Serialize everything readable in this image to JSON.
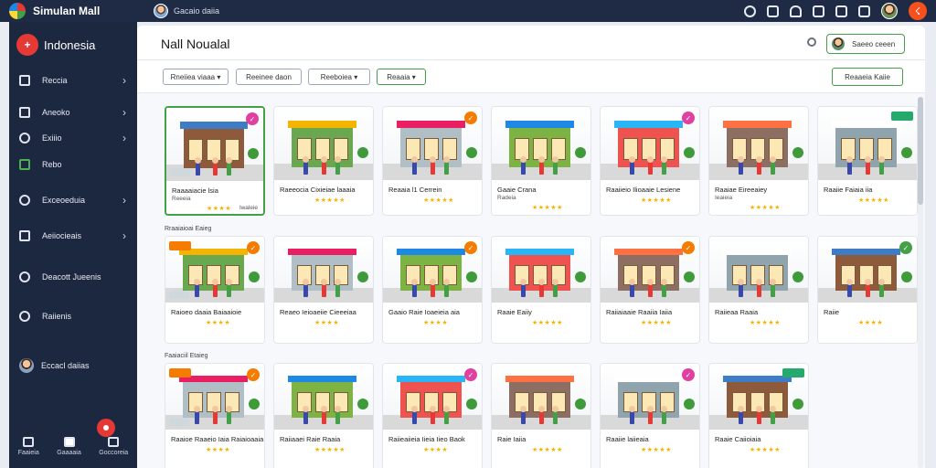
{
  "app": {
    "title": "Simulan Mall",
    "user_label": "Gacaio daiia",
    "accent": "#43a047",
    "top_icons": [
      "headset-icon",
      "menu-icon",
      "bell-icon",
      "instagram-icon",
      "chat-icon",
      "share-icon"
    ]
  },
  "sidebar": {
    "region_badge": "+",
    "region_label": "Indonesia",
    "items": [
      {
        "label": "Reccia",
        "icon": "store-icon",
        "chevron": "›"
      },
      {
        "label": "Aneoko",
        "icon": "grid-icon",
        "chevron": "›"
      },
      {
        "label": "Exiiio",
        "icon": "people-icon",
        "chevron": "›"
      },
      {
        "label": "Rebo",
        "icon": "camera-icon",
        "chevron": ""
      },
      {
        "label": "Exceoeduia",
        "icon": "settings-icon",
        "chevron": "›"
      },
      {
        "label": "Aeiiocieais",
        "icon": "upload-icon",
        "chevron": "›"
      },
      {
        "label": "Deacott Jueenis",
        "icon": "history-icon",
        "chevron": ""
      },
      {
        "label": "Raiienis",
        "icon": "help-icon",
        "chevron": ""
      }
    ],
    "user_label": "Eccacl daiias",
    "bottom_nav": [
      {
        "label": "Faaieia",
        "icon": "home-icon"
      },
      {
        "label": "Gaaaaia",
        "icon": "chat-icon"
      },
      {
        "label": "Goccoreia",
        "icon": "list-icon"
      }
    ]
  },
  "header": {
    "title": "Nall Noualal",
    "profile_label": "Saeeo ceeen"
  },
  "filters": [
    {
      "label": "Rneiiea viaaa",
      "chevron": "▾"
    },
    {
      "label": "Reeinee daon",
      "chevron": ""
    },
    {
      "label": "Reeboiea",
      "chevron": "▾"
    },
    {
      "label": "Reaaia",
      "chevron": "▾"
    }
  ],
  "action_button": "Reaaeia Kaiie",
  "sections": [
    "Rraaiaioai Eaieg",
    "Faaiaciil Etaieg"
  ],
  "rows": [
    [
      {
        "name": "Raaaaiacie lsia",
        "meta": "Reeeia",
        "stars": "★★★★",
        "extra": "lwaleie",
        "badge": "✓",
        "badge_color": "#e040a0",
        "selected": true
      },
      {
        "name": "Raeeocia Cixieiae laaaia",
        "meta": "",
        "stars": "★★★★★",
        "extra": "",
        "badge": "",
        "badge_color": "",
        "selected": false
      },
      {
        "name": "Reaaia l1 Cerrein",
        "meta": "",
        "stars": "★★★★★",
        "extra": "",
        "badge": "✓",
        "badge_color": "#f57c00",
        "selected": false
      },
      {
        "name": "Gaaie Crana",
        "meta": "Radeia",
        "stars": "★★★★★",
        "extra": "",
        "badge": "",
        "badge_color": "",
        "selected": false
      },
      {
        "name": "Raaiieio Ilioaaie Lesiene",
        "meta": "",
        "stars": "★★★★★",
        "extra": "",
        "badge": "✓",
        "badge_color": "#e040a0",
        "selected": false
      },
      {
        "name": "Raaiae Eireeaiey",
        "meta": "Ieaieia",
        "stars": "★★★★★",
        "extra": "",
        "badge": "",
        "badge_color": "",
        "selected": false
      },
      {
        "name": "Raaiie Faiaia iia",
        "meta": "",
        "stars": "★★★★★",
        "extra": "",
        "badge": "",
        "badge_color": "",
        "selected": false,
        "tag": "",
        "tag_color": "#26a96c"
      }
    ],
    [
      {
        "name": "Raioeo daaia Baiaaioie",
        "meta": "",
        "stars": "★★★★",
        "extra": "",
        "badge": "✓",
        "badge_color": "#f57c00",
        "selected": false,
        "tag": "",
        "tag_color": "#f57c00"
      },
      {
        "name": "Reaeo Ieioaeiie Cieeeiaa",
        "meta": "",
        "stars": "★★★★",
        "extra": "",
        "badge": "",
        "badge_color": "",
        "selected": false
      },
      {
        "name": "Gaaio Raie Ioaeieia aia",
        "meta": "",
        "stars": "★★★★",
        "extra": "",
        "badge": "✓",
        "badge_color": "#f57c00",
        "selected": false
      },
      {
        "name": "Raaie Eaiiy",
        "meta": "",
        "stars": "★★★★★",
        "extra": "",
        "badge": "",
        "badge_color": "",
        "selected": false
      },
      {
        "name": "Raiiaiaaie Raaiia Iaiia",
        "meta": "",
        "stars": "★★★★★",
        "extra": "",
        "badge": "✓",
        "badge_color": "#f57c00",
        "selected": false
      },
      {
        "name": "Raiieaa Raaia",
        "meta": "",
        "stars": "★★★★★",
        "extra": "",
        "badge": "",
        "badge_color": "",
        "selected": false
      },
      {
        "name": "Raiie",
        "meta": "",
        "stars": "★★★★",
        "extra": "",
        "badge": "✓",
        "badge_color": "#43a047",
        "selected": false
      }
    ],
    [
      {
        "name": "Raaioe Raaeio Iaia Raiaioaaia",
        "meta": "",
        "stars": "★★★★",
        "extra": "",
        "badge": "✓",
        "badge_color": "#f57c00",
        "selected": false,
        "tag": "",
        "tag_color": "#f57c00"
      },
      {
        "name": "Raiiaaei Raie Raaia",
        "meta": "",
        "stars": "★★★★★",
        "extra": "",
        "badge": "",
        "badge_color": "",
        "selected": false
      },
      {
        "name": "Raiieaiieia Iieia Iieo Baok",
        "meta": "",
        "stars": "★★★★",
        "extra": "",
        "badge": "✓",
        "badge_color": "#e040a0",
        "selected": false
      },
      {
        "name": "Raie Iaiia",
        "meta": "",
        "stars": "★★★★★",
        "extra": "",
        "badge": "",
        "badge_color": "",
        "selected": false
      },
      {
        "name": "Raaiie laiieaia",
        "meta": "",
        "stars": "★★★★★",
        "extra": "",
        "badge": "✓",
        "badge_color": "#e040a0",
        "selected": false
      },
      {
        "name": "Raaie Caiioiaia",
        "meta": "",
        "stars": "★★★★★",
        "extra": "",
        "badge": "",
        "badge_color": "",
        "selected": false,
        "tag": "",
        "tag_color": "#26a96c"
      }
    ]
  ]
}
